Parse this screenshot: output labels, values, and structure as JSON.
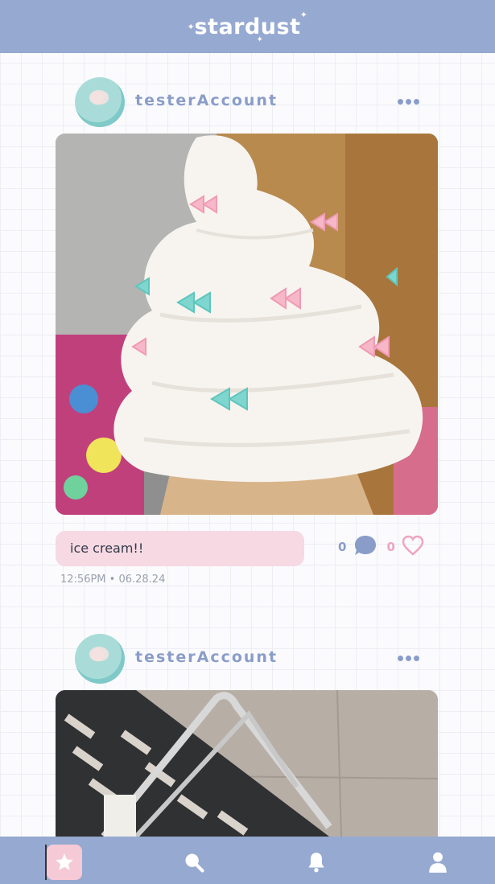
{
  "app": {
    "brand": "stardust"
  },
  "colors": {
    "header": "#96a9d1",
    "accent_blue": "#8a9dc9",
    "accent_pink": "#f0a4bd",
    "caption_bg": "#f6d9e3"
  },
  "posts": [
    {
      "username": "testerAccount",
      "caption": "ice cream!!",
      "comments_count": "0",
      "likes_count": "0",
      "timestamp": "12:56PM • 06.28.24",
      "image": "soft-serve-ice-cream-with-bows"
    },
    {
      "username": "testerAccount",
      "image": "shopping-basket-on-tile-floor"
    }
  ],
  "nav": [
    {
      "name": "home",
      "icon": "star-icon",
      "active": true
    },
    {
      "name": "search",
      "icon": "search-icon"
    },
    {
      "name": "notifications",
      "icon": "bell-icon"
    },
    {
      "name": "profile",
      "icon": "user-icon"
    }
  ]
}
